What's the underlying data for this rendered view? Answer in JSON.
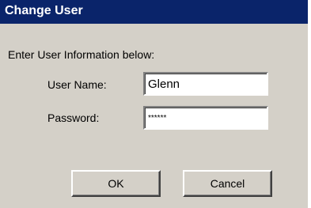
{
  "dialog": {
    "title": "Change User",
    "prompt": "Enter User Information below:",
    "username_label": "User Name:",
    "username_value": "Glenn",
    "password_label": "Password:",
    "password_value": "******",
    "ok_label": "OK",
    "cancel_label": "Cancel"
  },
  "colors": {
    "titlebar": "#0a246a",
    "face": "#d4d0c8"
  }
}
